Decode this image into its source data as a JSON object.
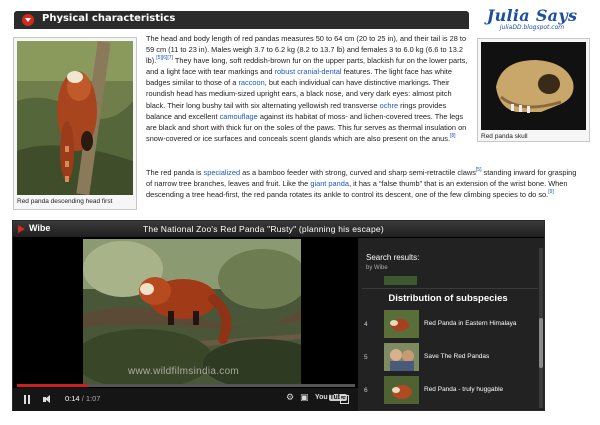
{
  "section": {
    "title": "Physical characteristics"
  },
  "brand": {
    "name": "Julia Says",
    "url": "juliaDD.blogspot.com"
  },
  "thumbs": {
    "left_caption": "Red panda descending head first",
    "right_caption": "Red panda skull"
  },
  "para1": {
    "t1": "The head and body length of red pandas measures 50 to 64 cm (20 to 25 in), and their tail is 28 to 59 cm (11 to 23 in). Males weigh 3.7 to 6.2 kg (8.2 to 13.7 lb) and females 3 to 6.0 kg (6.6 to 13.2 lb).",
    "ref1": "[5][6][7]",
    "t2": " They have long, soft reddish-brown fur on the upper parts, blackish fur on the lower parts, and a light face with tear markings and ",
    "link_robust": "robust cranial-dental",
    "t3": " features. The light face has white badges similar to those of a ",
    "link_raccoon": "raccoon",
    "t4": ", but each individual can have distinctive markings. Their roundish head has medium-sized upright ears, a black nose, and very dark eyes: almost pitch black. Their long bushy tail with six alternating yellowish red transverse ",
    "link_ochre": "ochre",
    "t5": " rings provides balance and excellent ",
    "link_camouflage": "camouflage",
    "t6": " against its habitat of moss- and lichen-covered trees. The legs are black and short with thick fur on the soles of the paws. This fur serves as thermal insulation on snow-covered or ice surfaces and conceals scent glands which are also present on the anus.",
    "ref2": "[8]"
  },
  "para2": {
    "t1": "The red panda is ",
    "link_specialized": "specialized",
    "t2": " as a bamboo feeder with strong, curved and sharp semi-retractile claws",
    "ref1": "[5]",
    "t3": " standing inward for grasping of narrow tree branches, leaves and fruit. Like the ",
    "link_giant_panda": "giant panda",
    "t4": ", it has a “false thumb” that is an extension of the wrist bone. When descending a tree head-first, the red panda rotates its ankle to control its descent, one of the few climbing species to do so.",
    "ref2": "[9]"
  },
  "player": {
    "brand": "Wibe",
    "title": "The National Zoo's Red Panda \"Rusty\" (planning his escape)",
    "watermark": "www.wildfilmsindia.com",
    "time_current": "0:14",
    "time_duration": " / 1:07",
    "progress": 0.21,
    "gear_glyph": "⚙",
    "cc_glyph": "▣",
    "yt_you": "You",
    "yt_tube": "Tube"
  },
  "results": {
    "heading": "Search results:",
    "sub": "by Wibe",
    "section_title": "Distribution of subspecies",
    "items": [
      {
        "num": "4",
        "label": "Red Panda in Eastern Himalaya"
      },
      {
        "num": "5",
        "label": "Save The Red Pandas"
      },
      {
        "num": "6",
        "label": "Red Panda - truly huggable"
      }
    ]
  },
  "colors": {
    "header_bg": "#2b2b2b",
    "accent_red": "#cf2b1a",
    "link_blue": "#1a58c6",
    "brand_blue": "#1e4fa3",
    "player_bg": "#000000"
  }
}
